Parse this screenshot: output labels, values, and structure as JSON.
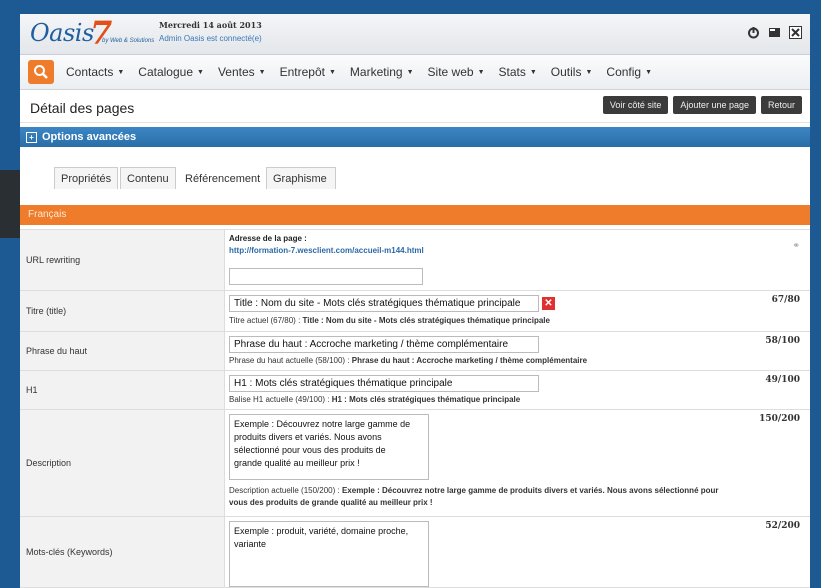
{
  "app": {
    "logo_text": "Oasis",
    "logo_number": "7",
    "logo_by": "by Web & Solutions",
    "date": "Mercredi 14 août 2013",
    "user_status": "Admin Oasis est connecté(e)"
  },
  "top_icons": [
    "power-icon",
    "layout-icon",
    "close-icon"
  ],
  "nav": {
    "items": [
      {
        "label": "Contacts"
      },
      {
        "label": "Catalogue"
      },
      {
        "label": "Ventes"
      },
      {
        "label": "Entrepôt"
      },
      {
        "label": "Marketing"
      },
      {
        "label": "Site web"
      },
      {
        "label": "Stats"
      },
      {
        "label": "Outils"
      },
      {
        "label": "Config"
      }
    ]
  },
  "header": {
    "title": "Détail des pages",
    "buttons": [
      "Voir côté site",
      "Ajouter une page",
      "Retour"
    ]
  },
  "advanced": {
    "label": "Options avancées"
  },
  "tabs": [
    {
      "label": "Propriétés",
      "active": false
    },
    {
      "label": "Contenu",
      "active": false
    },
    {
      "label": "Référencement",
      "active": true
    },
    {
      "label": "Graphisme",
      "active": false
    }
  ],
  "language_bar": "Français",
  "form": {
    "url": {
      "label": "URL rewriting",
      "address_label": "Adresse de la page :",
      "address_link": "http://formation-7.wesclient.com/accueil-m144.html",
      "value": ""
    },
    "title": {
      "label": "Titre (title)",
      "value": "Title : Nom du site - Mots clés stratégiques thématique principale",
      "counter": "67/80",
      "hint_prefix": "Titre actuel (67/80) : ",
      "hint_value": "Title : Nom du site - Mots clés stratégiques thématique principale"
    },
    "top_phrase": {
      "label": "Phrase du haut",
      "value": "Phrase du haut : Accroche marketing / thème complémentaire",
      "counter": "58/100",
      "hint_prefix": "Phrase du haut actuelle (58/100) : ",
      "hint_value": "Phrase du haut : Accroche marketing / thème complémentaire"
    },
    "h1": {
      "label": "H1",
      "value": "H1 : Mots clés stratégiques thématique principale",
      "counter": "49/100",
      "hint_prefix": "Balise H1 actuelle (49/100) : ",
      "hint_value": "H1 : Mots clés stratégiques thématique principale"
    },
    "description": {
      "label": "Description",
      "value": "Exemple : Découvrez notre large gamme de\nproduits divers et variés. Nous avons\nsélectionné pour vous des produits de\ngrande qualité au meilleur prix !",
      "counter": "150/200",
      "hint_prefix": "Description actuelle (150/200) : ",
      "hint_value_line1": "Exemple : Découvrez notre large gamme de produits divers et variés. Nous avons sélectionné pour",
      "hint_value_line2": "vous des produits de grande qualité au meilleur prix !"
    },
    "keywords": {
      "label": "Mots-clés (Keywords)",
      "value": "Exemple : produit, variété, domaine proche,\nvariante",
      "counter": "52/200"
    }
  }
}
